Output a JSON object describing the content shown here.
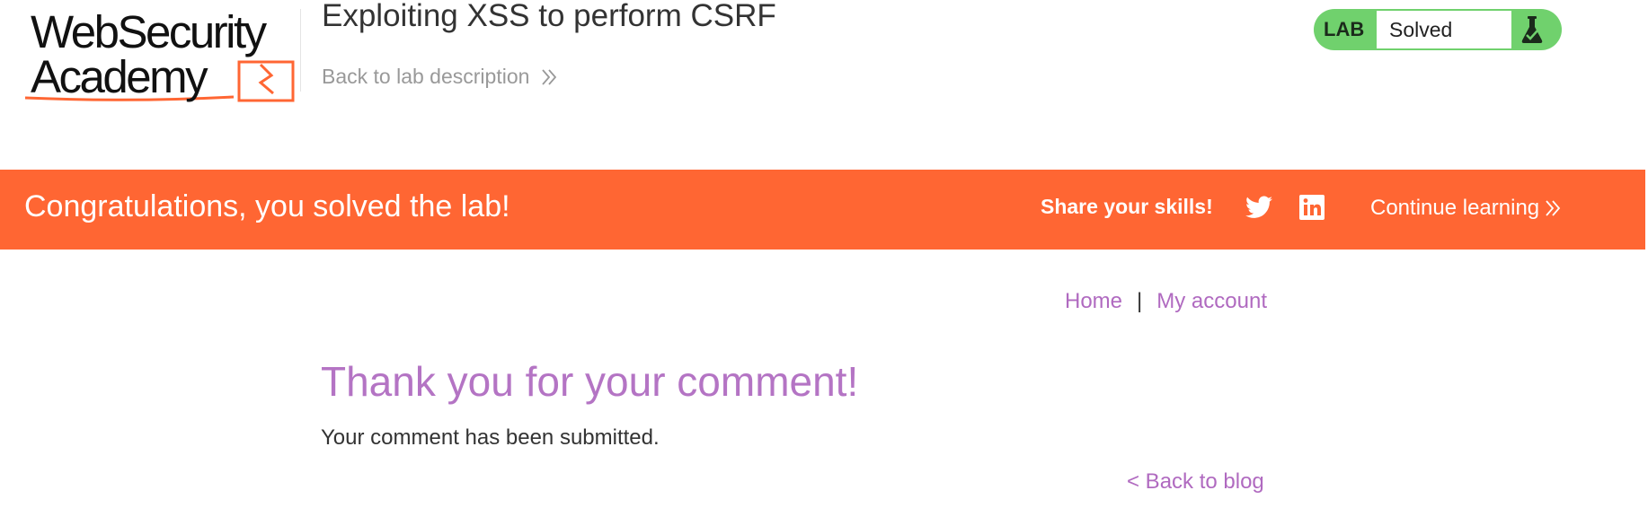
{
  "logo": {
    "line1": "WebSecurity",
    "line2": "Academy",
    "colors": {
      "text": "#111111",
      "accent": "#ff6633"
    }
  },
  "header": {
    "title": "Exploiting XSS to perform CSRF",
    "back_link": "Back to lab description",
    "back_icon": "double-chevron-right-icon"
  },
  "lab_status": {
    "tag": "LAB",
    "state": "Solved",
    "icon": "flask-icon",
    "color": "#70d16d"
  },
  "banner": {
    "message": "Congratulations, you solved the lab!",
    "share_label": "Share your skills!",
    "share_icons": [
      "twitter-icon",
      "linkedin-icon"
    ],
    "continue_label": "Continue learning",
    "color": "#ff6633"
  },
  "nav": {
    "home": "Home",
    "separator": "|",
    "account": "My account",
    "link_color": "#b06ac0"
  },
  "content": {
    "heading": "Thank you for your comment!",
    "message": "Your comment has been submitted.",
    "back_link": "< Back to blog"
  }
}
